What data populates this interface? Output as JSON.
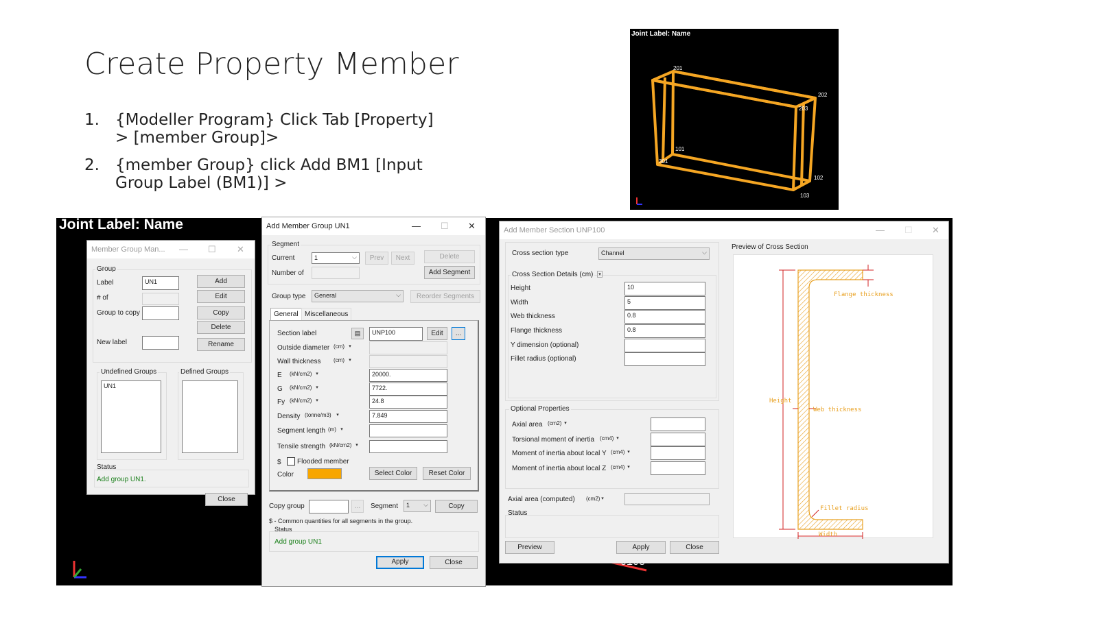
{
  "slide": {
    "title": "Create Property Member",
    "steps": [
      {
        "num": "1.",
        "line1": "{Modeller Program} Click Tab [Property]",
        "line2": "> [member Group]>"
      },
      {
        "num": "2.",
        "line1": "{member Group} click Add  BM1 [Input",
        "line2": "Group Label (BM1)] >"
      }
    ]
  },
  "viewport_top": {
    "header": "Joint Label: Name",
    "joint_labels": [
      "201",
      "202",
      "203",
      "101",
      "102",
      "103",
      "301"
    ],
    "frame_color": "#f5a623"
  },
  "viewport_bottom": {
    "header": "Joint Label: Name",
    "joint_label": "0103"
  },
  "member_group_manager": {
    "title": "Member Group Man...",
    "group_section": "Group",
    "label_label": "Label",
    "label_value": "UN1",
    "num_of_label": "# of",
    "group_to_copy_label": "Group to copy",
    "new_label_label": "New label",
    "add_btn": "Add",
    "edit_btn": "Edit",
    "copy_btn": "Copy",
    "delete_btn": "Delete",
    "rename_btn": "Rename",
    "undefined_groups_label": "Undefined Groups",
    "undefined_groups": [
      "UN1"
    ],
    "defined_groups_label": "Defined Groups",
    "status_label": "Status",
    "status_text": "Add group UN1.",
    "close_btn": "Close"
  },
  "add_member_group": {
    "title": "Add Member Group UN1",
    "segment_section": "Segment",
    "current_label": "Current",
    "current_value": "1",
    "prev_btn": "Prev",
    "next_btn": "Next",
    "delete_btn": "Delete",
    "number_of_label": "Number of",
    "add_segment_btn": "Add Segment",
    "group_type_label": "Group type",
    "group_type_value": "General",
    "reorder_btn": "Reorder Segments",
    "tabs": [
      "General",
      "Miscellaneous"
    ],
    "section_label_label": "Section label",
    "section_label_value": "UNP100",
    "edit_btn": "Edit",
    "browse_btn": "...",
    "props": [
      {
        "label": "Outside diameter",
        "unit": "(cm)",
        "value": "",
        "disabled": true
      },
      {
        "label": "Wall thickness",
        "unit": "(cm)",
        "value": "",
        "disabled": true
      },
      {
        "label": "E",
        "unit": "(kN/cm2)",
        "value": "20000.",
        "disabled": false
      },
      {
        "label": "G",
        "unit": "(kN/cm2)",
        "value": "7722.",
        "disabled": false
      },
      {
        "label": "Fy",
        "unit": "(kN/cm2)",
        "value": "24.8",
        "disabled": false
      },
      {
        "label": "Density",
        "unit": "(tonne/m3)",
        "value": "7.849",
        "disabled": false
      },
      {
        "label": "Segment length",
        "unit": "(m)",
        "value": "",
        "disabled": false
      },
      {
        "label": "Tensile strength",
        "unit": "(kN/cm2)",
        "value": "",
        "disabled": false
      }
    ],
    "dollar": "$",
    "flooded_label": "Flooded member",
    "color_label": "Color",
    "color_swatch": "#f7a600",
    "select_color_btn": "Select Color",
    "reset_color_btn": "Reset Color",
    "copy_group_label": "Copy group",
    "copy_browse_btn": "...",
    "segment_label": "Segment",
    "segment_value": "1",
    "copy_btn": "Copy",
    "note": "$ - Common quantities for all segments in the group.",
    "status_label": "Status",
    "status_text": "Add group UN1",
    "apply_btn": "Apply",
    "close_btn": "Close"
  },
  "add_member_section": {
    "title": "Add Member Section UNP100",
    "cross_type_label": "Cross section type",
    "cross_type_value": "Channel",
    "details_label": "Cross Section Details  (cm)",
    "details": [
      {
        "label": "Height",
        "value": "10"
      },
      {
        "label": "Width",
        "value": "5"
      },
      {
        "label": "Web thickness",
        "value": "0.8"
      },
      {
        "label": "Flange thickness",
        "value": "0.8"
      },
      {
        "label": "Y dimension (optional)",
        "value": ""
      },
      {
        "label": "Fillet radius (optional)",
        "value": ""
      }
    ],
    "optional_label": "Optional Properties",
    "optional": [
      {
        "label": "Axial area",
        "unit": "(cm2)",
        "value": ""
      },
      {
        "label": "Torsional moment of inertia",
        "unit": "(cm4)",
        "value": ""
      },
      {
        "label": "Moment of inertia about local Y",
        "unit": "(cm4)",
        "value": ""
      },
      {
        "label": "Moment of inertia about local Z",
        "unit": "(cm4)",
        "value": ""
      }
    ],
    "axial_computed_label": "Axial area (computed)",
    "axial_computed_unit": "(cm2)",
    "status_label": "Status",
    "preview_label": "Preview of Cross Section",
    "diagram_labels": {
      "flange": "Flange thickness",
      "height": "Height",
      "web": "Web thickness",
      "fillet": "Fillet radius",
      "width": "Width"
    },
    "preview_btn": "Preview",
    "apply_btn": "Apply",
    "close_btn": "Close"
  }
}
